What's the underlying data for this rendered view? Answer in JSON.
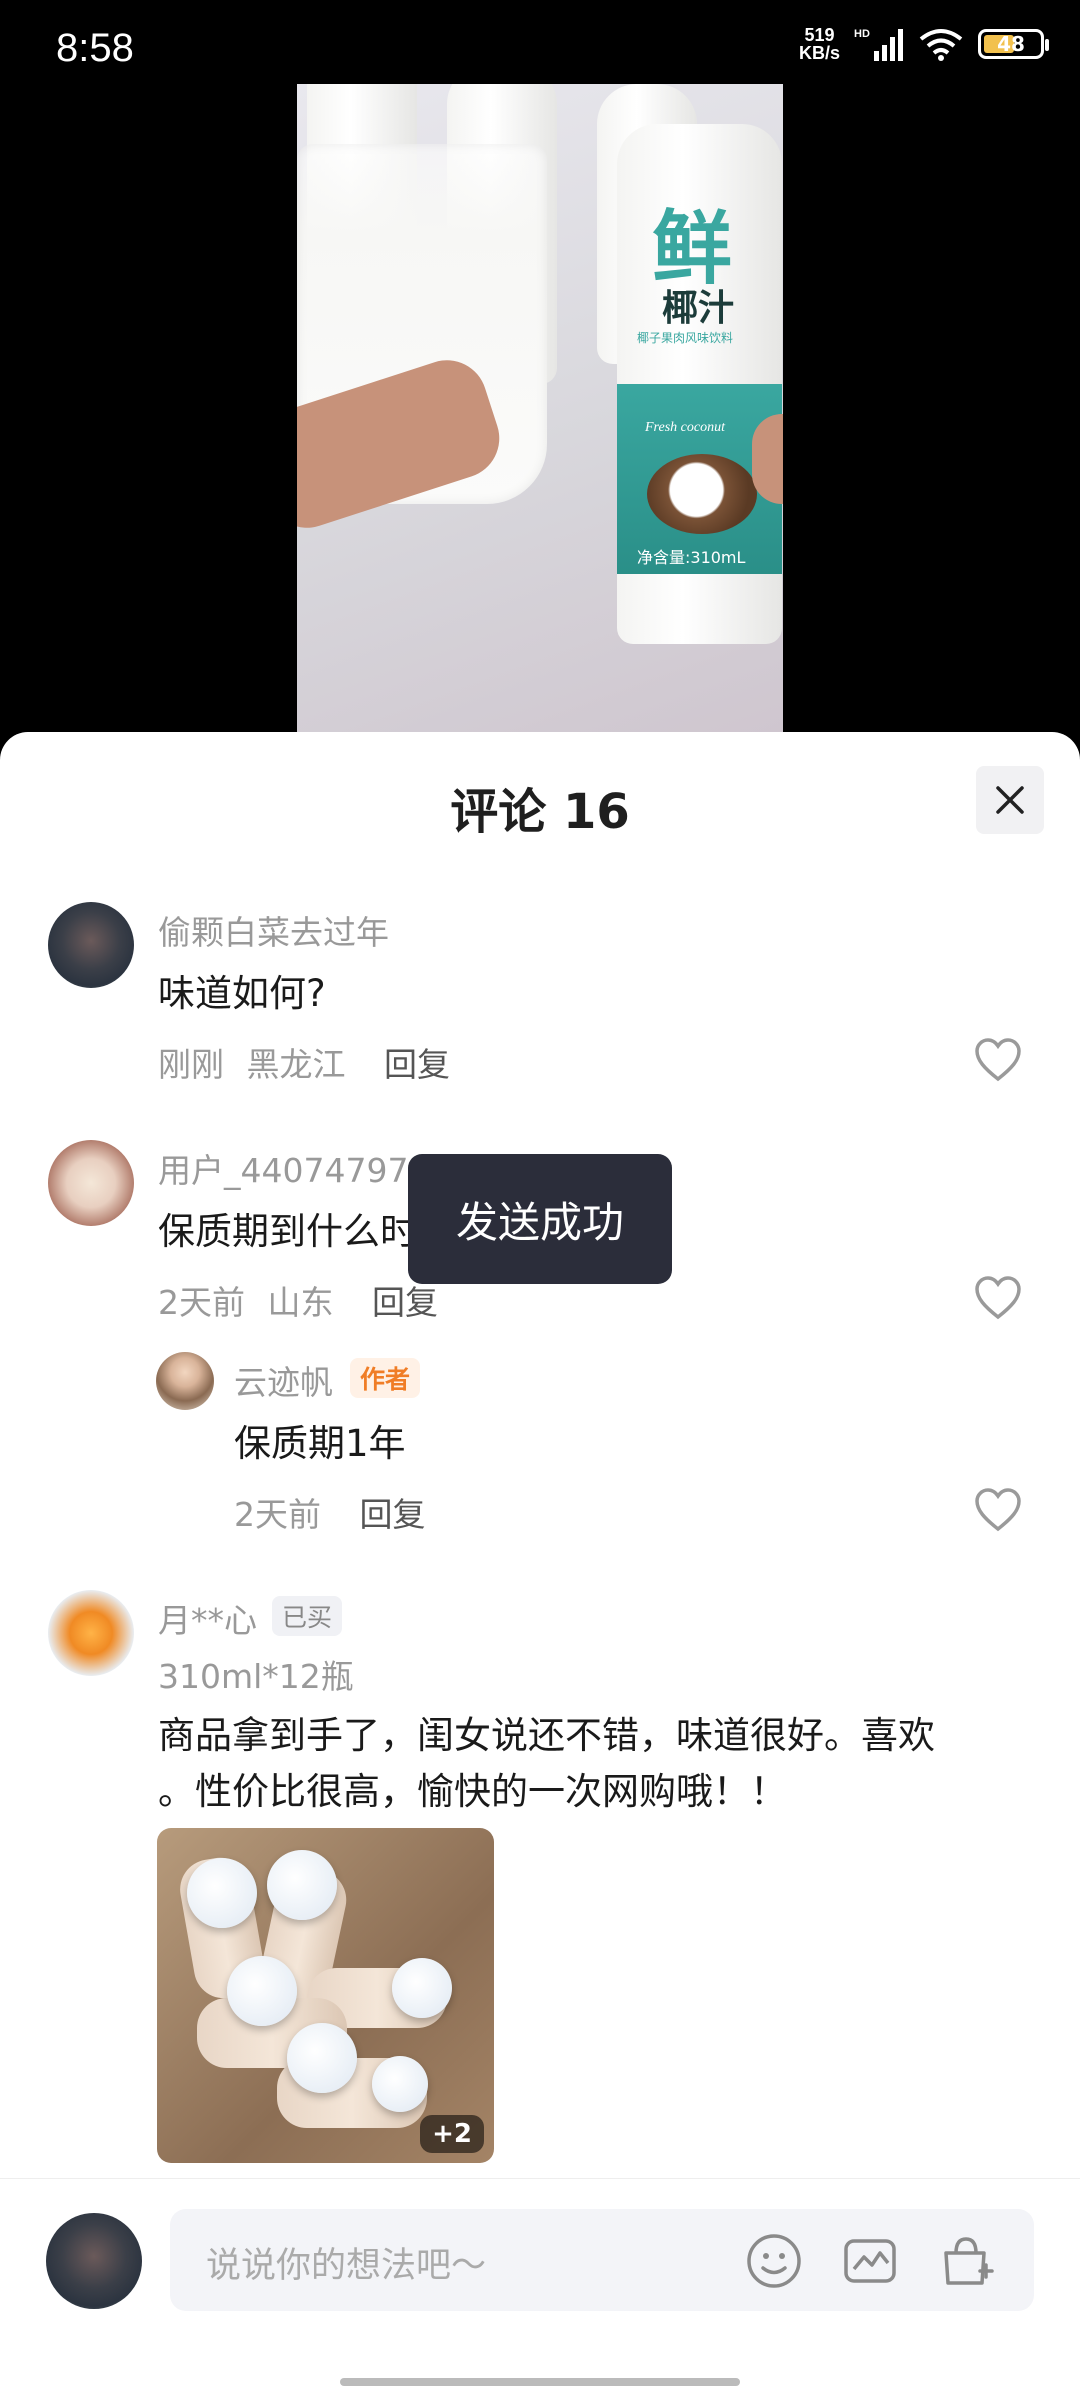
{
  "status": {
    "time": "8:58",
    "net_speed": "519",
    "net_unit": "KB/s",
    "hd": "HD",
    "battery": "48"
  },
  "video": {
    "brand": "鲜",
    "product": "椰汁",
    "subtitle": "椰子果肉风味饮料",
    "tag": "Fresh coconut",
    "volume": "净含量:310mL"
  },
  "sheet": {
    "title": "评论 16"
  },
  "comments": [
    {
      "user": "偷颗白菜去过年",
      "text": "味道如何?",
      "time": "刚刚",
      "location": "黑龙江",
      "reply": "回复"
    },
    {
      "user": "用户_44074797",
      "text": "保质期到什么时候?",
      "time": "2天前",
      "location": "山东",
      "reply": "回复",
      "replies": [
        {
          "user": "云迹帆",
          "badge": "作者",
          "text": "保质期1年",
          "time": "2天前",
          "reply": "回复"
        }
      ]
    },
    {
      "user": "月**心",
      "badge": "已买",
      "spec": "310ml*12瓶",
      "text_line1": "商品拿到手了，闺女说还不错，味道很好。喜欢",
      "text_line2": "。性价比很高，愉快的一次网购哦！！",
      "more_images": "+2"
    }
  ],
  "toast": "发送成功",
  "input": {
    "placeholder": "说说你的想法吧～"
  },
  "colors": {
    "author_badge_bg": "#fff1e6",
    "author_badge_text": "#f07d26",
    "bought_badge_bg": "#f0f1f5",
    "toast_bg": "#2b2d3a"
  }
}
